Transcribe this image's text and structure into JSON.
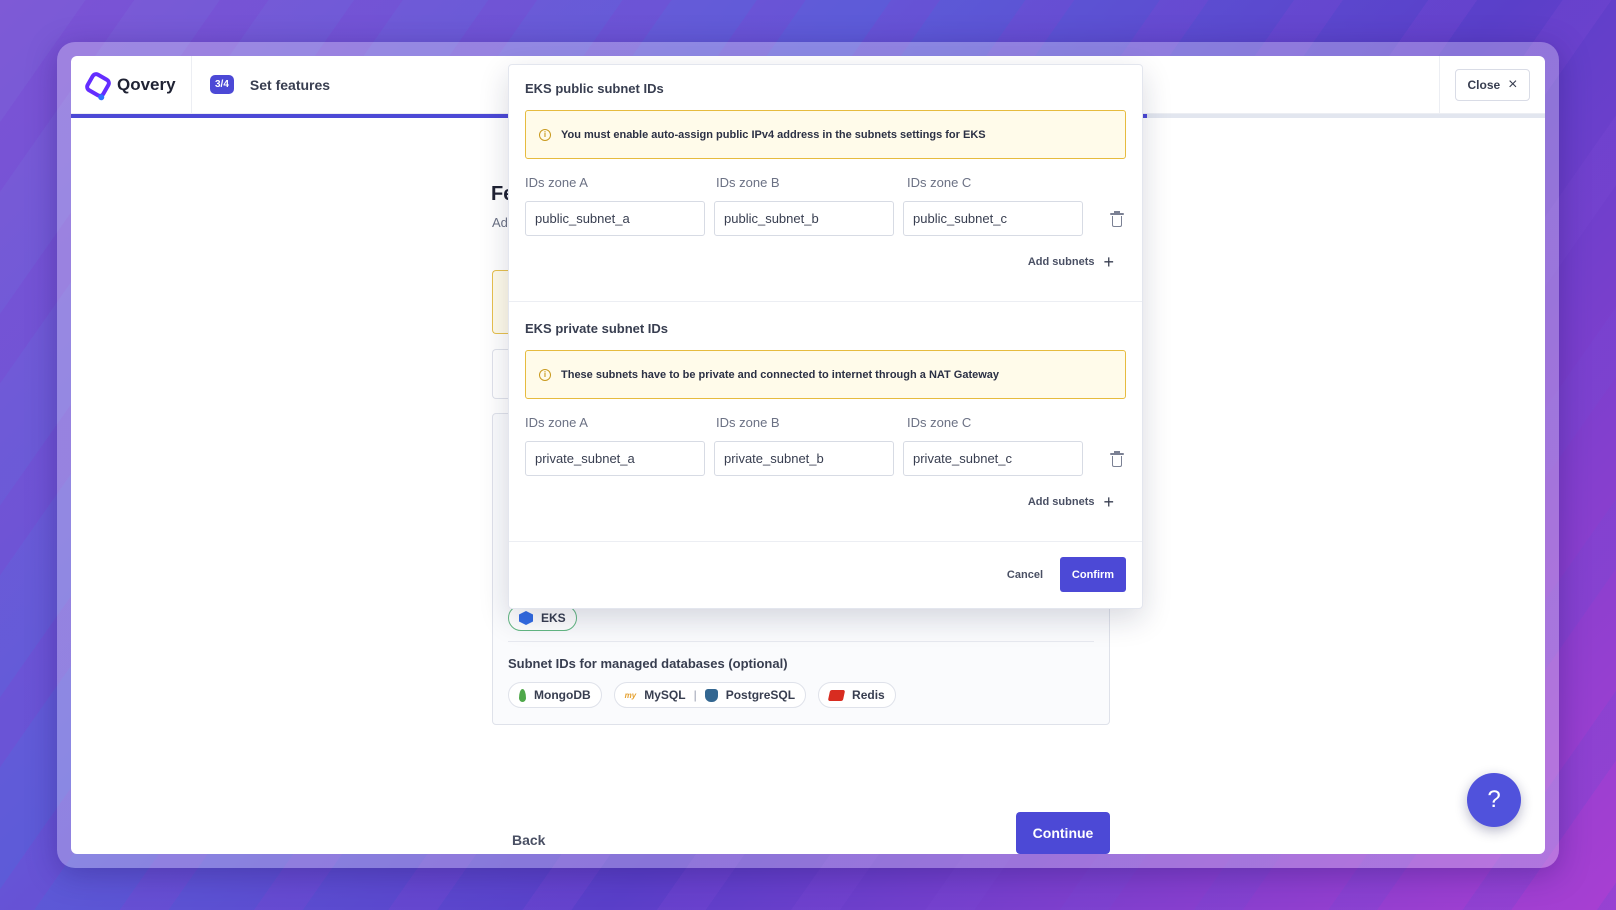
{
  "brand": {
    "name": "Qovery"
  },
  "step": {
    "badge": "3/4",
    "title": "Set features"
  },
  "header": {
    "close_label": "Close"
  },
  "progress": {
    "fraction": 0.73
  },
  "background": {
    "title_fragment": "Fe",
    "subtitle_fragment": "Ad",
    "eks_chip": "EKS",
    "db_title": "Subnet IDs for managed databases (optional)",
    "db_chips": {
      "mongodb": "MongoDB",
      "mysql": "MySQL",
      "separator": "|",
      "postgresql": "PostgreSQL",
      "redis": "Redis"
    },
    "back_label": "Back",
    "continue_label": "Continue"
  },
  "modal": {
    "public": {
      "title": "EKS public subnet IDs",
      "notice": "You must enable auto-assign public IPv4 address in the subnets settings for EKS",
      "zone_a_label": "IDs zone A",
      "zone_b_label": "IDs zone B",
      "zone_c_label": "IDs zone C",
      "zone_a_value": "public_subnet_a",
      "zone_b_value": "public_subnet_b",
      "zone_c_value": "public_subnet_c",
      "add_label": "Add subnets"
    },
    "private": {
      "title": "EKS private subnet IDs",
      "notice": "These subnets have to be private and connected to internet through a NAT Gateway",
      "zone_a_label": "IDs zone A",
      "zone_b_label": "IDs zone B",
      "zone_c_label": "IDs zone C",
      "zone_a_value": "private_subnet_a",
      "zone_b_value": "private_subnet_b",
      "zone_c_value": "private_subnet_c",
      "add_label": "Add subnets"
    },
    "cancel_label": "Cancel",
    "confirm_label": "Confirm"
  },
  "help": {
    "glyph": "?"
  }
}
